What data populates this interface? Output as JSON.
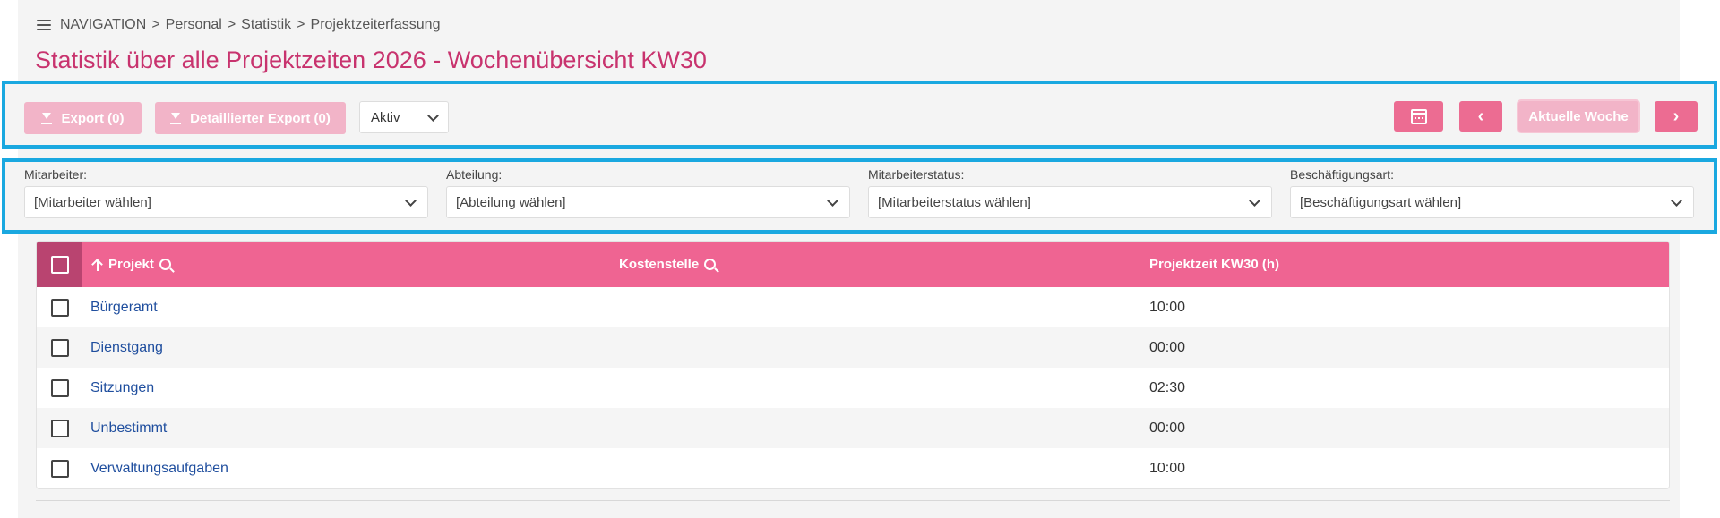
{
  "breadcrumb": {
    "menu_icon": "hamburger-menu-icon",
    "items": [
      "NAVIGATION",
      "Personal",
      "Statistik",
      "Projektzeiterfassung"
    ],
    "separator": ">"
  },
  "page": {
    "title": "Statistik über alle Projektzeiten 2026 - Wochenübersicht KW30"
  },
  "toolbar": {
    "export_label": "Export (0)",
    "detailed_export_label": "Detaillierter Export (0)",
    "status_select_value": "Aktiv",
    "calendar_icon": "calendar-icon",
    "prev_label": "‹",
    "current_week_label": "Aktuelle Woche",
    "next_label": "›"
  },
  "filters": {
    "mitarbeiter": {
      "label": "Mitarbeiter:",
      "value": "[Mitarbeiter wählen]"
    },
    "abteilung": {
      "label": "Abteilung:",
      "value": "[Abteilung wählen]"
    },
    "mitarbeiterstatus": {
      "label": "Mitarbeiterstatus:",
      "value": "[Mitarbeiterstatus wählen]"
    },
    "beschaeftigungsart": {
      "label": "Beschäftigungsart:",
      "value": "[Beschäftigungsart wählen]"
    }
  },
  "table": {
    "columns": [
      "Projekt",
      "Kostenstelle",
      "Projektzeit KW30 (h)"
    ],
    "rows": [
      {
        "projekt": "Bürgeramt",
        "kostenstelle": "",
        "zeit": "10:00"
      },
      {
        "projekt": "Dienstgang",
        "kostenstelle": "",
        "zeit": "00:00"
      },
      {
        "projekt": "Sitzungen",
        "kostenstelle": "",
        "zeit": "02:30"
      },
      {
        "projekt": "Unbestimmt",
        "kostenstelle": "",
        "zeit": "00:00"
      },
      {
        "projekt": "Verwaltungsaufgaben",
        "kostenstelle": "",
        "zeit": "10:00"
      }
    ]
  },
  "colors": {
    "accent": "#ef6492",
    "title": "#c8336e",
    "highlight_border": "#1aa8e0",
    "link": "#1f4e9e"
  }
}
